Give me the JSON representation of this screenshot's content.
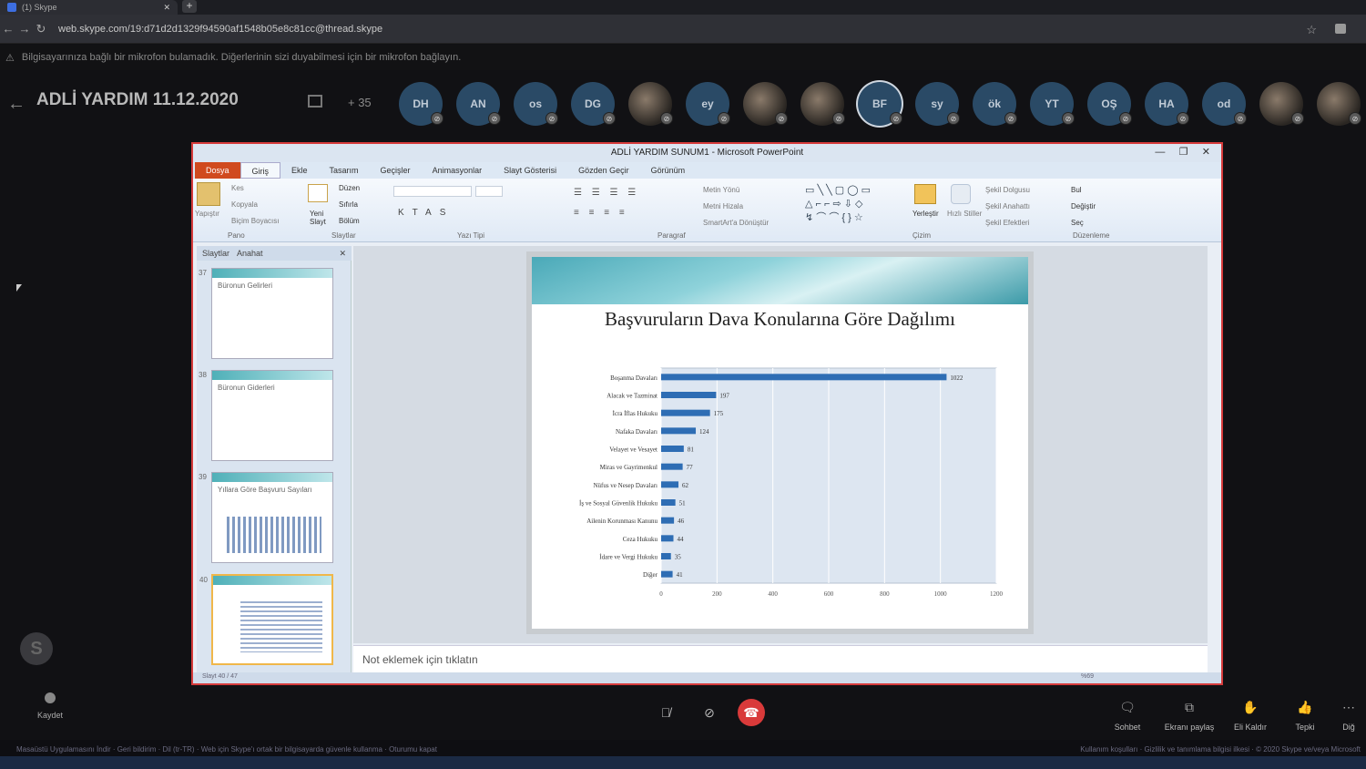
{
  "browser": {
    "tab_title": "(1) Skype",
    "url": "web.skype.com/19:d71d2d1329f94590af1548b05e8c81cc@thread.skype"
  },
  "warning": "Bilgisayarınıza bağlı bir mikrofon bulamadık. Diğerlerinin sizi duyabilmesi için bir mikrofon bağlayın.",
  "call": {
    "title": "ADLİ YARDIM 11.12.2020",
    "extra_participants": "+ 35",
    "participants": [
      {
        "initials": "DH",
        "photo": false
      },
      {
        "initials": "AN",
        "photo": false
      },
      {
        "initials": "os",
        "photo": false
      },
      {
        "initials": "DG",
        "photo": false
      },
      {
        "initials": "",
        "photo": true
      },
      {
        "initials": "ey",
        "photo": false
      },
      {
        "initials": "",
        "photo": true
      },
      {
        "initials": "",
        "photo": true
      },
      {
        "initials": "BF",
        "photo": false
      },
      {
        "initials": "sy",
        "photo": false
      },
      {
        "initials": "ök",
        "photo": false
      },
      {
        "initials": "YT",
        "photo": false
      },
      {
        "initials": "OŞ",
        "photo": false
      },
      {
        "initials": "HA",
        "photo": false
      },
      {
        "initials": "od",
        "photo": false
      },
      {
        "initials": "",
        "photo": true
      },
      {
        "initials": "",
        "photo": true
      }
    ]
  },
  "ppt": {
    "window_title": "ADLİ YARDIM SUNUM1 - Microsoft PowerPoint",
    "tabs": [
      "Dosya",
      "Giriş",
      "Ekle",
      "Tasarım",
      "Geçişler",
      "Animasyonlar",
      "Slayt Gösterisi",
      "Gözden Geçir",
      "Görünüm"
    ],
    "groups": {
      "pano": "Pano",
      "slaytlar": "Slaytlar",
      "yazi_tipi": "Yazı Tipi",
      "paragraf": "Paragraf",
      "cizim": "Çizim",
      "duzenleme": "Düzenleme"
    },
    "buttons": {
      "yapistir": "Yapıştır",
      "kes": "Kes",
      "kopyala": "Kopyala",
      "bicim": "Biçim Boyacısı",
      "yeni_slayt": "Yeni Slayt",
      "duzen": "Düzen",
      "sifirla": "Sıfırla",
      "bolum": "Bölüm",
      "metin_yonu": "Metin Yönü",
      "metni_hizala": "Metni Hizala",
      "smartart": "SmartArt'a Dönüştür",
      "yerlestir": "Yerleştir",
      "hizli_stiller": "Hızlı Stiller",
      "sekil_dolgusu": "Şekil Dolgusu",
      "sekil_anahati": "Şekil Anahattı",
      "sekil_efektleri": "Şekil Efektleri",
      "bul": "Bul",
      "degistir": "Değiştir",
      "sec": "Seç"
    },
    "pane_tabs": [
      "Slaytlar",
      "Anahat"
    ],
    "thumbnails": [
      {
        "num": "37",
        "title": "Büronun Gelirleri"
      },
      {
        "num": "38",
        "title": "Büronun Giderleri"
      },
      {
        "num": "39",
        "title": "Yıllara Göre Başvuru Sayıları"
      },
      {
        "num": "40",
        "title": ""
      }
    ],
    "slide_title": "Başvuruların Dava Konularına Göre Dağılımı",
    "notes_placeholder": "Not eklemek için tıklatın",
    "status": "Slayt 40 / 47",
    "zoom": "%69"
  },
  "chart_data": {
    "type": "bar",
    "orientation": "horizontal",
    "categories": [
      "Boşanma Davaları",
      "Alacak ve Tazminat",
      "İcra İflas Hukuku",
      "Nafaka Davaları",
      "Velayet ve Vesayet",
      "Miras ve Gayrimenkul",
      "Nüfus ve Nesep Davaları",
      "İş ve Sosyal Güvenlik Hukuku",
      "Ailenin Korunması Kanunu",
      "Ceza Hukuku",
      "İdare ve Vergi Hukuku",
      "Diğer"
    ],
    "values": [
      1022,
      197,
      175,
      124,
      81,
      77,
      62,
      51,
      46,
      44,
      35,
      41
    ],
    "xlim": [
      0,
      1200
    ],
    "xticks": [
      0,
      200,
      400,
      600,
      800,
      1000,
      1200
    ],
    "grid": true,
    "bar_color": "#2e6db4"
  },
  "bottom": {
    "record": "Kaydet",
    "right_buttons": [
      "Sohbet",
      "Ekranı paylaş",
      "Eli Kaldır",
      "Tepki",
      "Diğ"
    ]
  },
  "footer": {
    "left": "Masaüstü Uygulamasını İndir  ·  Geri bildirim  ·  Dil (tr-TR)  ·  Web için Skype'ı ortak bir bilgisayarda güvenle kullanma  ·  Oturumu kapat",
    "right": "Kullanım koşulları  ·  Gizlilik ve tanımlama bilgisi ilkesi  ·  © 2020 Skype ve/veya Microsoft"
  }
}
